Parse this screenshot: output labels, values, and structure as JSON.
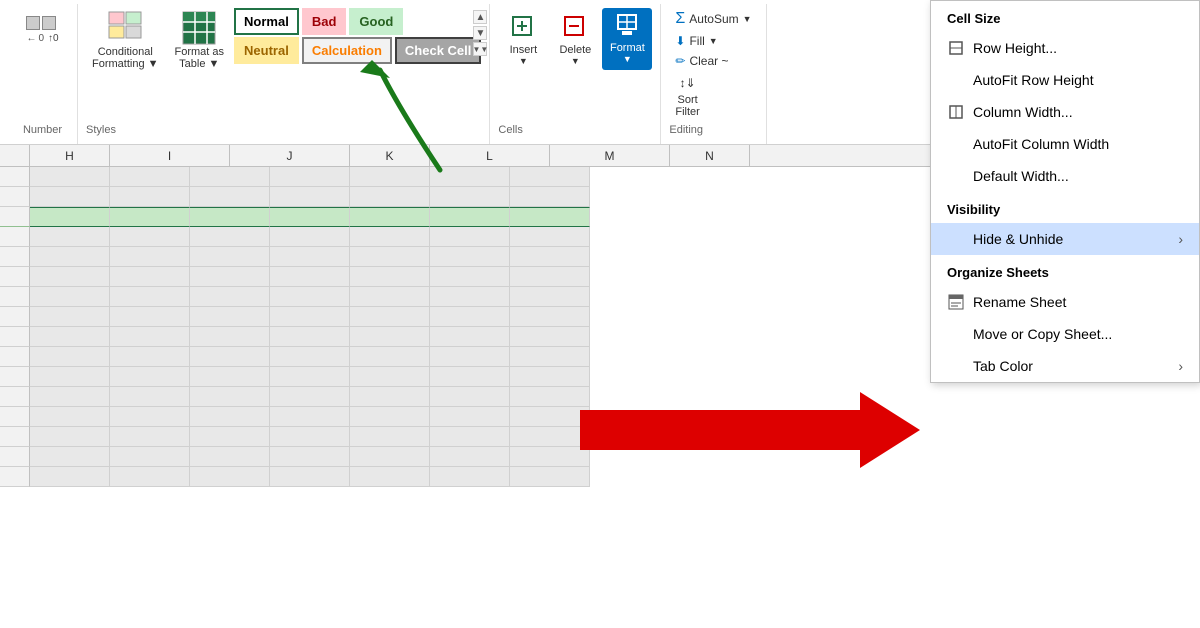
{
  "ribbon": {
    "styles_label": "Styles",
    "cells_label": "Cells",
    "editing_label": "Editing",
    "style_cells": [
      {
        "id": "normal",
        "label": "Normal",
        "class": "style-normal"
      },
      {
        "id": "bad",
        "label": "Bad",
        "class": "style-bad"
      },
      {
        "id": "good",
        "label": "Good",
        "class": "style-good"
      },
      {
        "id": "neutral",
        "label": "Neutral",
        "class": "style-neutral"
      },
      {
        "id": "calculation",
        "label": "Calculation",
        "class": "style-calculation"
      },
      {
        "id": "check",
        "label": "Check Cell",
        "class": "style-check"
      }
    ],
    "insert_label": "Insert",
    "delete_label": "Delete",
    "format_label": "Format",
    "autosum_label": "AutoSum",
    "fill_label": "Fill",
    "clear_label": "Clear ~",
    "sort_label": "Sort\nFilter"
  },
  "columns": [
    "H",
    "I",
    "J",
    "K",
    "L",
    "M",
    "N"
  ],
  "dropdown": {
    "cell_size_header": "Cell Size",
    "row_height": "Row Height...",
    "autofit_row": "AutoFit Row Height",
    "column_width": "Column Width...",
    "autofit_column": "AutoFit Column Width",
    "default_width": "Default Width...",
    "visibility_header": "Visibility",
    "hide_unhide": "Hide & Unhide",
    "organize_header": "Organize Sheets",
    "rename_sheet": "Rename Sheet",
    "move_copy": "Move or Copy Sheet...",
    "tab_color": "Tab Color",
    "highlighted_item": "hide_unhide"
  }
}
